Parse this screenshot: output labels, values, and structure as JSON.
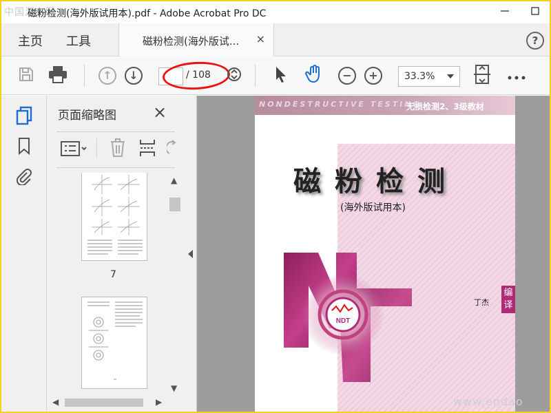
{
  "watermark_top": "中国源东网",
  "window": {
    "title": "磁粉检测(海外版试用本).pdf - Adobe Acrobat Pro DC"
  },
  "menu": {
    "home": "主页",
    "tools": "工具"
  },
  "tab": {
    "label": "磁粉检测(海外版试...",
    "close": "×"
  },
  "help_glyph": "?",
  "toolbar": {
    "page_current": "",
    "page_total": "/ 108",
    "zoom": "33.3%"
  },
  "panel": {
    "title": "页面缩略图",
    "close": "×",
    "page_label": "7"
  },
  "cover": {
    "band_en": "NONDESTRUCTIVE TESTING",
    "band_cn": "无损检测2、3级教材",
    "title": "磁粉检测",
    "subtitle": "(海外版试用本)",
    "author": "丁杰",
    "editor_tag": "编译",
    "logo_text": "NDT"
  },
  "watermark_bottom": "www.endao",
  "colors": {
    "magenta": "#b02a78",
    "highlight_ring": "#e11111",
    "frame": "#f1d31b"
  }
}
